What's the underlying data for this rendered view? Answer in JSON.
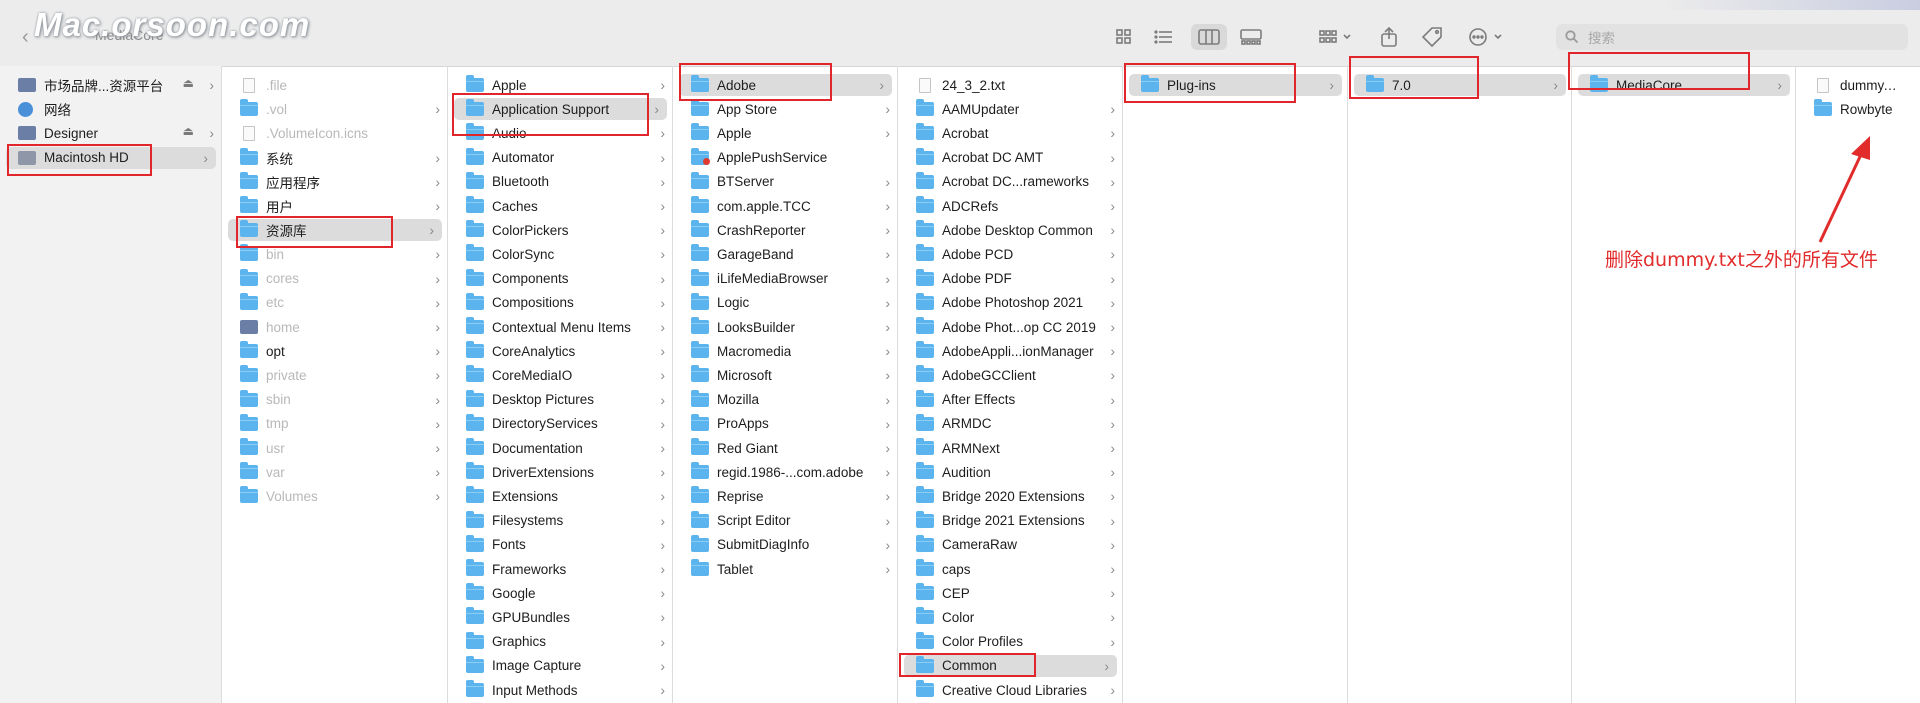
{
  "window": {
    "title": "MediaCore",
    "watermark": "Mac.orsoon.com"
  },
  "toolbar": {
    "buttons": [
      {
        "name": "icon-view-button",
        "icon": "grid-icon"
      },
      {
        "name": "list-view-button",
        "icon": "list-icon"
      },
      {
        "name": "column-view-button",
        "icon": "columns-icon",
        "active": true
      },
      {
        "name": "gallery-view-button",
        "icon": "gallery-icon"
      },
      {
        "name": "group-button",
        "icon": "group-icon"
      },
      {
        "name": "share-button",
        "icon": "share-icon"
      },
      {
        "name": "tag-button",
        "icon": "tag-icon"
      },
      {
        "name": "more-button",
        "icon": "ellipsis-icon"
      }
    ],
    "search": {
      "placeholder": "搜索"
    }
  },
  "sidebar": {
    "items": [
      {
        "label": "市场品牌...资源平台",
        "icon": "server-icon",
        "eject": true
      },
      {
        "label": "网络",
        "icon": "globe-icon"
      },
      {
        "label": "Designer",
        "icon": "server-icon",
        "eject": true
      },
      {
        "label": "Macintosh HD",
        "icon": "disk-icon",
        "selected": true
      }
    ]
  },
  "columns": [
    {
      "items": [
        {
          "label": ".file",
          "icon": "file-icon",
          "dim": true
        },
        {
          "label": ".vol",
          "icon": "folder-icon",
          "dim": true,
          "chevron": true
        },
        {
          "label": ".VolumeIcon.icns",
          "icon": "file-icon",
          "dim": true
        },
        {
          "label": "系统",
          "icon": "folder-icon",
          "chevron": true
        },
        {
          "label": "应用程序",
          "icon": "folder-icon",
          "chevron": true
        },
        {
          "label": "用户",
          "icon": "folder-icon",
          "chevron": true
        },
        {
          "label": "资源库",
          "icon": "folder-icon",
          "chevron": true,
          "selected": true
        },
        {
          "label": "bin",
          "icon": "folder-icon",
          "dim": true,
          "chevron": true
        },
        {
          "label": "cores",
          "icon": "folder-icon",
          "dim": true,
          "chevron": true
        },
        {
          "label": "etc",
          "icon": "folder-icon",
          "dim": true,
          "chevron": true
        },
        {
          "label": "home",
          "icon": "server-icon",
          "dim": true,
          "chevron": true
        },
        {
          "label": "opt",
          "icon": "folder-icon",
          "chevron": true
        },
        {
          "label": "private",
          "icon": "folder-icon",
          "dim": true,
          "chevron": true
        },
        {
          "label": "sbin",
          "icon": "folder-icon",
          "dim": true,
          "chevron": true
        },
        {
          "label": "tmp",
          "icon": "folder-icon",
          "dim": true,
          "chevron": true
        },
        {
          "label": "usr",
          "icon": "folder-icon",
          "dim": true,
          "chevron": true
        },
        {
          "label": "var",
          "icon": "folder-icon",
          "dim": true,
          "chevron": true
        },
        {
          "label": "Volumes",
          "icon": "folder-icon",
          "dim": true,
          "chevron": true
        }
      ]
    },
    {
      "items": [
        {
          "label": "Apple",
          "icon": "folder-icon",
          "chevron": true
        },
        {
          "label": "Application Support",
          "icon": "folder-icon",
          "chevron": true,
          "selected": true
        },
        {
          "label": "Audio",
          "icon": "folder-icon",
          "chevron": true
        },
        {
          "label": "Automator",
          "icon": "folder-icon",
          "chevron": true
        },
        {
          "label": "Bluetooth",
          "icon": "folder-icon",
          "chevron": true
        },
        {
          "label": "Caches",
          "icon": "folder-icon",
          "chevron": true
        },
        {
          "label": "ColorPickers",
          "icon": "folder-icon",
          "chevron": true
        },
        {
          "label": "ColorSync",
          "icon": "folder-icon",
          "chevron": true
        },
        {
          "label": "Components",
          "icon": "folder-icon",
          "chevron": true
        },
        {
          "label": "Compositions",
          "icon": "folder-icon",
          "chevron": true
        },
        {
          "label": "Contextual Menu Items",
          "icon": "folder-icon",
          "chevron": true
        },
        {
          "label": "CoreAnalytics",
          "icon": "folder-icon",
          "chevron": true
        },
        {
          "label": "CoreMediaIO",
          "icon": "folder-icon",
          "chevron": true
        },
        {
          "label": "Desktop Pictures",
          "icon": "folder-icon",
          "chevron": true
        },
        {
          "label": "DirectoryServices",
          "icon": "folder-icon",
          "chevron": true
        },
        {
          "label": "Documentation",
          "icon": "folder-icon",
          "chevron": true
        },
        {
          "label": "DriverExtensions",
          "icon": "folder-icon",
          "chevron": true
        },
        {
          "label": "Extensions",
          "icon": "folder-icon",
          "chevron": true
        },
        {
          "label": "Filesystems",
          "icon": "folder-icon",
          "chevron": true
        },
        {
          "label": "Fonts",
          "icon": "folder-icon",
          "chevron": true
        },
        {
          "label": "Frameworks",
          "icon": "folder-icon",
          "chevron": true
        },
        {
          "label": "Google",
          "icon": "folder-icon",
          "chevron": true
        },
        {
          "label": "GPUBundles",
          "icon": "folder-icon",
          "chevron": true
        },
        {
          "label": "Graphics",
          "icon": "folder-icon",
          "chevron": true
        },
        {
          "label": "Image Capture",
          "icon": "folder-icon",
          "chevron": true
        },
        {
          "label": "Input Methods",
          "icon": "folder-icon",
          "chevron": true
        }
      ]
    },
    {
      "items": [
        {
          "label": "Adobe",
          "icon": "folder-icon",
          "chevron": true,
          "selected": true
        },
        {
          "label": "App Store",
          "icon": "folder-icon",
          "chevron": true
        },
        {
          "label": "Apple",
          "icon": "folder-icon",
          "chevron": true
        },
        {
          "label": "ApplePushService",
          "icon": "folder-icon",
          "badge": true
        },
        {
          "label": "BTServer",
          "icon": "folder-icon",
          "chevron": true
        },
        {
          "label": "com.apple.TCC",
          "icon": "folder-icon",
          "chevron": true
        },
        {
          "label": "CrashReporter",
          "icon": "folder-icon",
          "chevron": true
        },
        {
          "label": "GarageBand",
          "icon": "folder-icon",
          "chevron": true
        },
        {
          "label": "iLifeMediaBrowser",
          "icon": "folder-icon",
          "chevron": true
        },
        {
          "label": "Logic",
          "icon": "folder-icon",
          "chevron": true
        },
        {
          "label": "LooksBuilder",
          "icon": "folder-icon",
          "chevron": true
        },
        {
          "label": "Macromedia",
          "icon": "folder-icon",
          "chevron": true
        },
        {
          "label": "Microsoft",
          "icon": "folder-icon",
          "chevron": true
        },
        {
          "label": "Mozilla",
          "icon": "folder-icon",
          "chevron": true
        },
        {
          "label": "ProApps",
          "icon": "folder-icon",
          "chevron": true
        },
        {
          "label": "Red Giant",
          "icon": "folder-icon",
          "chevron": true
        },
        {
          "label": "regid.1986-...com.adobe",
          "icon": "folder-icon",
          "chevron": true
        },
        {
          "label": "Reprise",
          "icon": "folder-icon",
          "chevron": true
        },
        {
          "label": "Script Editor",
          "icon": "folder-icon",
          "chevron": true
        },
        {
          "label": "SubmitDiagInfo",
          "icon": "folder-icon",
          "chevron": true
        },
        {
          "label": "Tablet",
          "icon": "folder-icon",
          "chevron": true
        }
      ]
    },
    {
      "items": [
        {
          "label": "24_3_2.txt",
          "icon": "file-icon"
        },
        {
          "label": "AAMUpdater",
          "icon": "folder-icon",
          "chevron": true
        },
        {
          "label": "Acrobat",
          "icon": "folder-icon",
          "chevron": true
        },
        {
          "label": "Acrobat DC AMT",
          "icon": "folder-icon",
          "chevron": true
        },
        {
          "label": "Acrobat DC...rameworks",
          "icon": "folder-icon",
          "chevron": true
        },
        {
          "label": "ADCRefs",
          "icon": "folder-icon",
          "chevron": true
        },
        {
          "label": "Adobe Desktop Common",
          "icon": "folder-icon",
          "chevron": true
        },
        {
          "label": "Adobe PCD",
          "icon": "folder-icon",
          "chevron": true
        },
        {
          "label": "Adobe PDF",
          "icon": "folder-icon",
          "chevron": true
        },
        {
          "label": "Adobe Photoshop 2021",
          "icon": "folder-icon",
          "chevron": true
        },
        {
          "label": "Adobe Phot...op CC 2019",
          "icon": "folder-icon",
          "chevron": true
        },
        {
          "label": "AdobeAppli...ionManager",
          "icon": "folder-icon",
          "chevron": true
        },
        {
          "label": "AdobeGCClient",
          "icon": "folder-icon",
          "chevron": true
        },
        {
          "label": "After Effects",
          "icon": "folder-icon",
          "chevron": true
        },
        {
          "label": "ARMDC",
          "icon": "folder-icon",
          "chevron": true
        },
        {
          "label": "ARMNext",
          "icon": "folder-icon",
          "chevron": true
        },
        {
          "label": "Audition",
          "icon": "folder-icon",
          "chevron": true
        },
        {
          "label": "Bridge 2020 Extensions",
          "icon": "folder-icon",
          "chevron": true
        },
        {
          "label": "Bridge 2021 Extensions",
          "icon": "folder-icon",
          "chevron": true
        },
        {
          "label": "CameraRaw",
          "icon": "folder-icon",
          "chevron": true
        },
        {
          "label": "caps",
          "icon": "folder-icon",
          "chevron": true
        },
        {
          "label": "CEP",
          "icon": "folder-icon",
          "chevron": true
        },
        {
          "label": "Color",
          "icon": "folder-icon",
          "chevron": true
        },
        {
          "label": "Color Profiles",
          "icon": "folder-icon",
          "chevron": true
        },
        {
          "label": "Common",
          "icon": "folder-icon",
          "chevron": true,
          "selected": true
        },
        {
          "label": "Creative Cloud Libraries",
          "icon": "folder-icon",
          "chevron": true
        }
      ]
    },
    {
      "items": [
        {
          "label": "Plug-ins",
          "icon": "folder-icon",
          "chevron": true,
          "selected": true
        }
      ]
    },
    {
      "items": [
        {
          "label": "7.0",
          "icon": "folder-icon",
          "chevron": true,
          "selected": true
        }
      ]
    },
    {
      "items": [
        {
          "label": "MediaCore",
          "icon": "folder-icon",
          "chevron": true,
          "selected": true
        }
      ]
    },
    {
      "items": [
        {
          "label": "dummy.txt",
          "icon": "file-icon"
        },
        {
          "label": "Rowbyte",
          "icon": "folder-icon"
        }
      ]
    }
  ],
  "annotation": {
    "text": "删除dummy.txt之外的所有文件",
    "color": "#e22b2b"
  },
  "colors": {
    "highlight_box": "#e0262a",
    "folder": "#5bb4ed",
    "selection": "#dcdcdc"
  }
}
